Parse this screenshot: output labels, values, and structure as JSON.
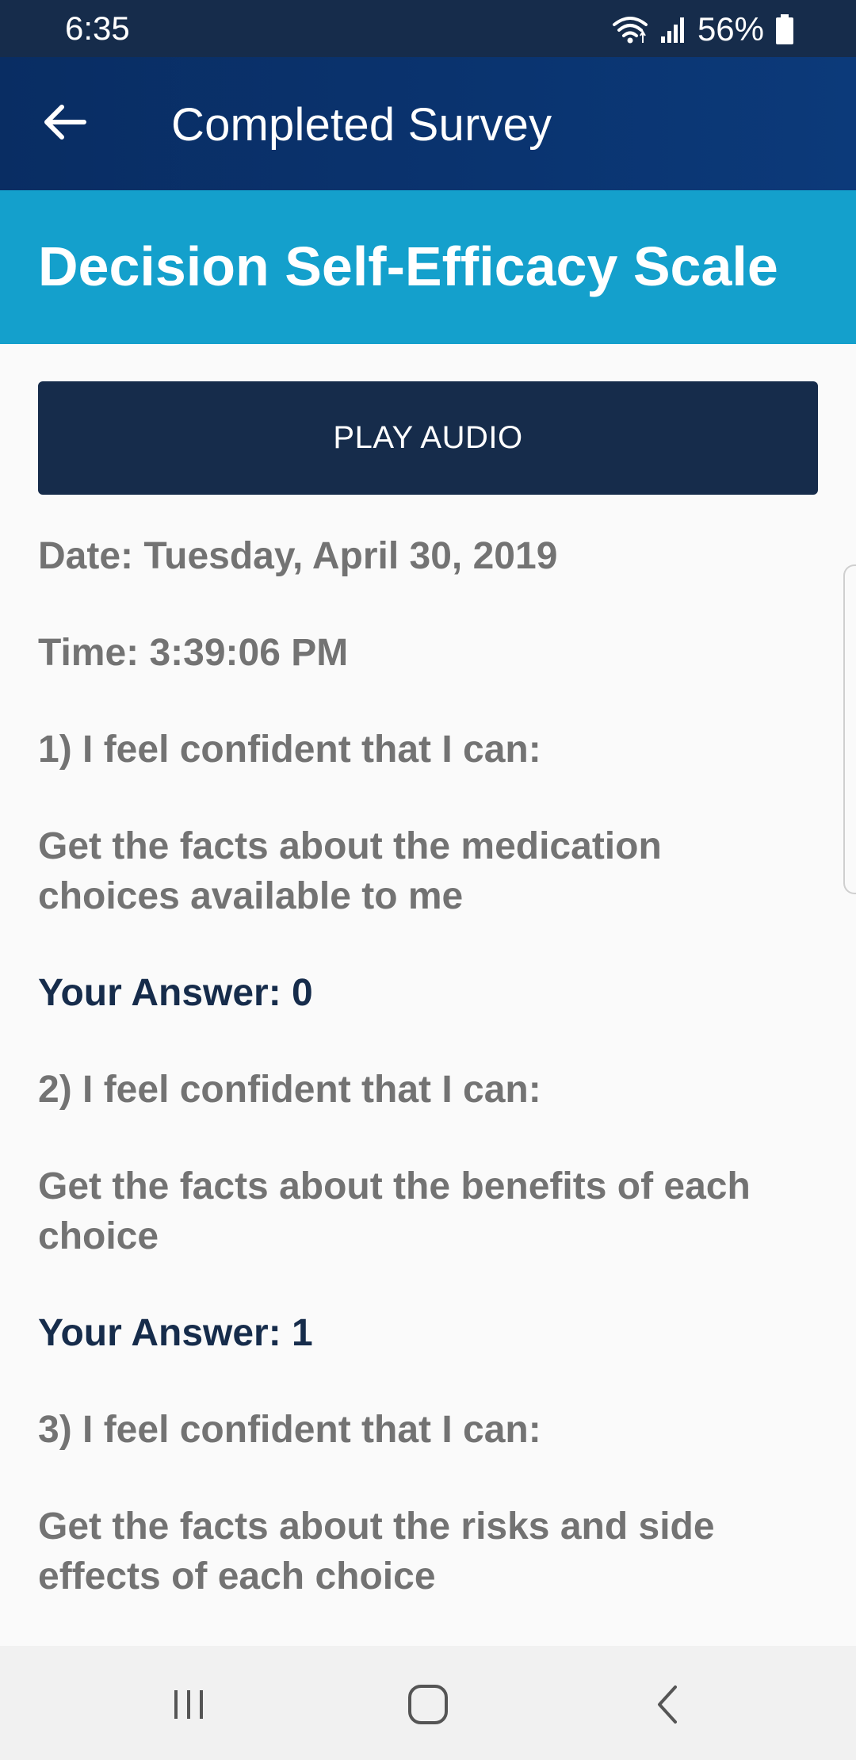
{
  "status_bar": {
    "time": "6:35",
    "battery": "56%",
    "icons": [
      "wifi-icon",
      "signal-icon",
      "battery-icon"
    ]
  },
  "app_bar": {
    "title": "Completed Survey",
    "back_icon": "arrow-left-icon"
  },
  "survey": {
    "title": "Decision Self-Efficacy Scale",
    "play_audio_label": "PLAY AUDIO",
    "date": "Date: Tuesday, April 30, 2019",
    "time": "Time: 3:39:06 PM",
    "questions": [
      {
        "prompt": "1) I feel confident that I can:",
        "text_lines": [
          "Get the facts about the medication",
          "choices available to me"
        ],
        "answer": "Your Answer: 0"
      },
      {
        "prompt": "2) I feel confident that I can:",
        "text_lines": [
          "Get the facts about the benefits of each",
          "choice"
        ],
        "answer": "Your Answer: 1"
      },
      {
        "prompt": "3) I feel confident that I can:",
        "text_lines": [
          "Get the facts about the risks and side",
          "effects of each choice"
        ]
      }
    ]
  },
  "nav_bar": {
    "icons": [
      "recent-apps-icon",
      "home-icon",
      "back-icon"
    ]
  },
  "colors": {
    "status_bar": "#162c4b",
    "app_bar": "#0a3470",
    "section_header": "#14a0cc",
    "button": "#162c4b",
    "body_text": "#737373",
    "answer_text": "#162c4b"
  }
}
